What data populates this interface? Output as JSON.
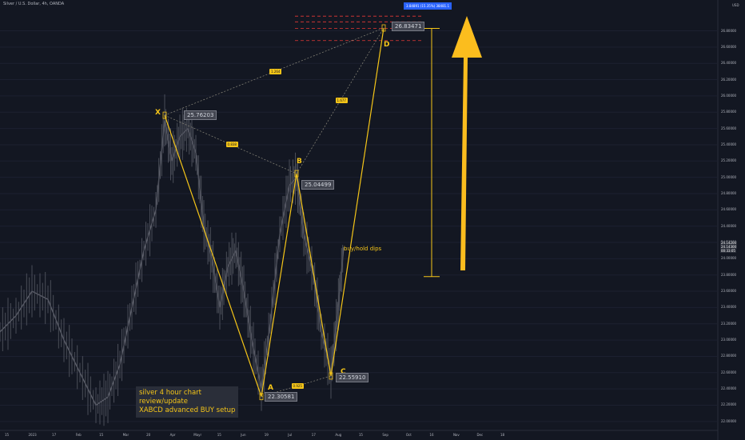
{
  "header": "Silver / U.S. Dollar, 4h, OANDA",
  "currency": "USD",
  "note_lines": [
    "silver 4 hour chart",
    "review/update",
    "XABCD advanced BUY setup"
  ],
  "buy_label": "buy/hold dips",
  "target_badge": "3.84891 (15.35%) 38481.1",
  "colors": {
    "pattern": "#f5c518",
    "background": "#131722",
    "price": "#5d606b",
    "target_lines": "#e53935",
    "badge": "#2962ff"
  },
  "chart_data": {
    "type": "line",
    "title": "",
    "xlabel": "",
    "ylabel": "",
    "ylim": [
      21.9,
      27.1
    ],
    "y_ticks": [
      22.0,
      22.2,
      22.4,
      22.6,
      22.8,
      23.0,
      23.2,
      23.4,
      23.6,
      23.8,
      24.0,
      24.2,
      24.4,
      24.6,
      24.8,
      25.0,
      25.2,
      25.4,
      25.6,
      25.8,
      26.0,
      26.2,
      26.4,
      26.6,
      26.8
    ],
    "y_tick_labels": [
      "22.00000",
      "22.20000",
      "22.40000",
      "22.60000",
      "22.80000",
      "23.00000",
      "23.20000",
      "23.40000",
      "23.60000",
      "23.80000",
      "24.00000",
      "24.20000",
      "24.40000",
      "24.60000",
      "24.80000",
      "25.00000",
      "25.20000",
      "25.40000",
      "25.60000",
      "25.80000",
      "26.00000",
      "26.20000",
      "26.40000",
      "26.60000",
      "26.80000"
    ],
    "current_price_labels": [
      "24.14200",
      "24.14300",
      "00:33:05"
    ],
    "x_tick_labels": [
      "15",
      "2023",
      "17",
      "Feb",
      "15",
      "Mar",
      "20",
      "Apr",
      "Mayr",
      "15",
      "Jun",
      "19",
      "Jul",
      "17",
      "Aug",
      "15",
      "Sep",
      "Oct",
      "16",
      "Nov",
      "Dec",
      "18"
    ],
    "pattern": {
      "name": "XABCD",
      "points": [
        {
          "label": "X",
          "index": 206,
          "price": 25.76203,
          "price_label": "25.76203"
        },
        {
          "label": "A",
          "index": 327,
          "price": 22.30581,
          "price_label": "22.30581"
        },
        {
          "label": "B",
          "index": 371,
          "price": 25.04499,
          "price_label": "25.04499"
        },
        {
          "label": "C",
          "index": 414,
          "price": 22.5591,
          "price_label": "22.55910"
        },
        {
          "label": "D",
          "index": 480,
          "price": 26.83471,
          "price_label": "26.83471"
        }
      ],
      "ratios": [
        {
          "value": "0.838",
          "between": [
            "X",
            "B"
          ]
        },
        {
          "value": "0.925",
          "between": [
            "A",
            "C"
          ]
        },
        {
          "value": "1.264",
          "between": [
            "X",
            "D"
          ]
        },
        {
          "value": "1.677",
          "between": [
            "B",
            "D"
          ]
        }
      ]
    },
    "target_levels": [
      26.83,
      26.91,
      26.98,
      26.68
    ],
    "projection": {
      "from": 23.78,
      "to": 26.83
    },
    "price_series": [
      {
        "i": 0,
        "p": 23.1
      },
      {
        "i": 20,
        "p": 23.3
      },
      {
        "i": 40,
        "p": 23.6
      },
      {
        "i": 60,
        "p": 23.5
      },
      {
        "i": 80,
        "p": 23.0
      },
      {
        "i": 100,
        "p": 22.6
      },
      {
        "i": 120,
        "p": 22.2
      },
      {
        "i": 135,
        "p": 22.3
      },
      {
        "i": 150,
        "p": 22.7
      },
      {
        "i": 165,
        "p": 23.4
      },
      {
        "i": 180,
        "p": 24.1
      },
      {
        "i": 195,
        "p": 24.6
      },
      {
        "i": 206,
        "p": 25.7
      },
      {
        "i": 215,
        "p": 25.2
      },
      {
        "i": 225,
        "p": 25.5
      },
      {
        "i": 235,
        "p": 25.6
      },
      {
        "i": 245,
        "p": 25.3
      },
      {
        "i": 255,
        "p": 24.4
      },
      {
        "i": 265,
        "p": 24.0
      },
      {
        "i": 275,
        "p": 23.4
      },
      {
        "i": 285,
        "p": 23.9
      },
      {
        "i": 295,
        "p": 24.1
      },
      {
        "i": 305,
        "p": 23.6
      },
      {
        "i": 315,
        "p": 23.0
      },
      {
        "i": 327,
        "p": 22.4
      },
      {
        "i": 338,
        "p": 23.2
      },
      {
        "i": 350,
        "p": 24.3
      },
      {
        "i": 362,
        "p": 24.9
      },
      {
        "i": 371,
        "p": 25.0
      },
      {
        "i": 380,
        "p": 24.3
      },
      {
        "i": 392,
        "p": 23.8
      },
      {
        "i": 402,
        "p": 23.1
      },
      {
        "i": 414,
        "p": 22.6
      },
      {
        "i": 422,
        "p": 23.3
      },
      {
        "i": 430,
        "p": 24.14
      }
    ]
  }
}
